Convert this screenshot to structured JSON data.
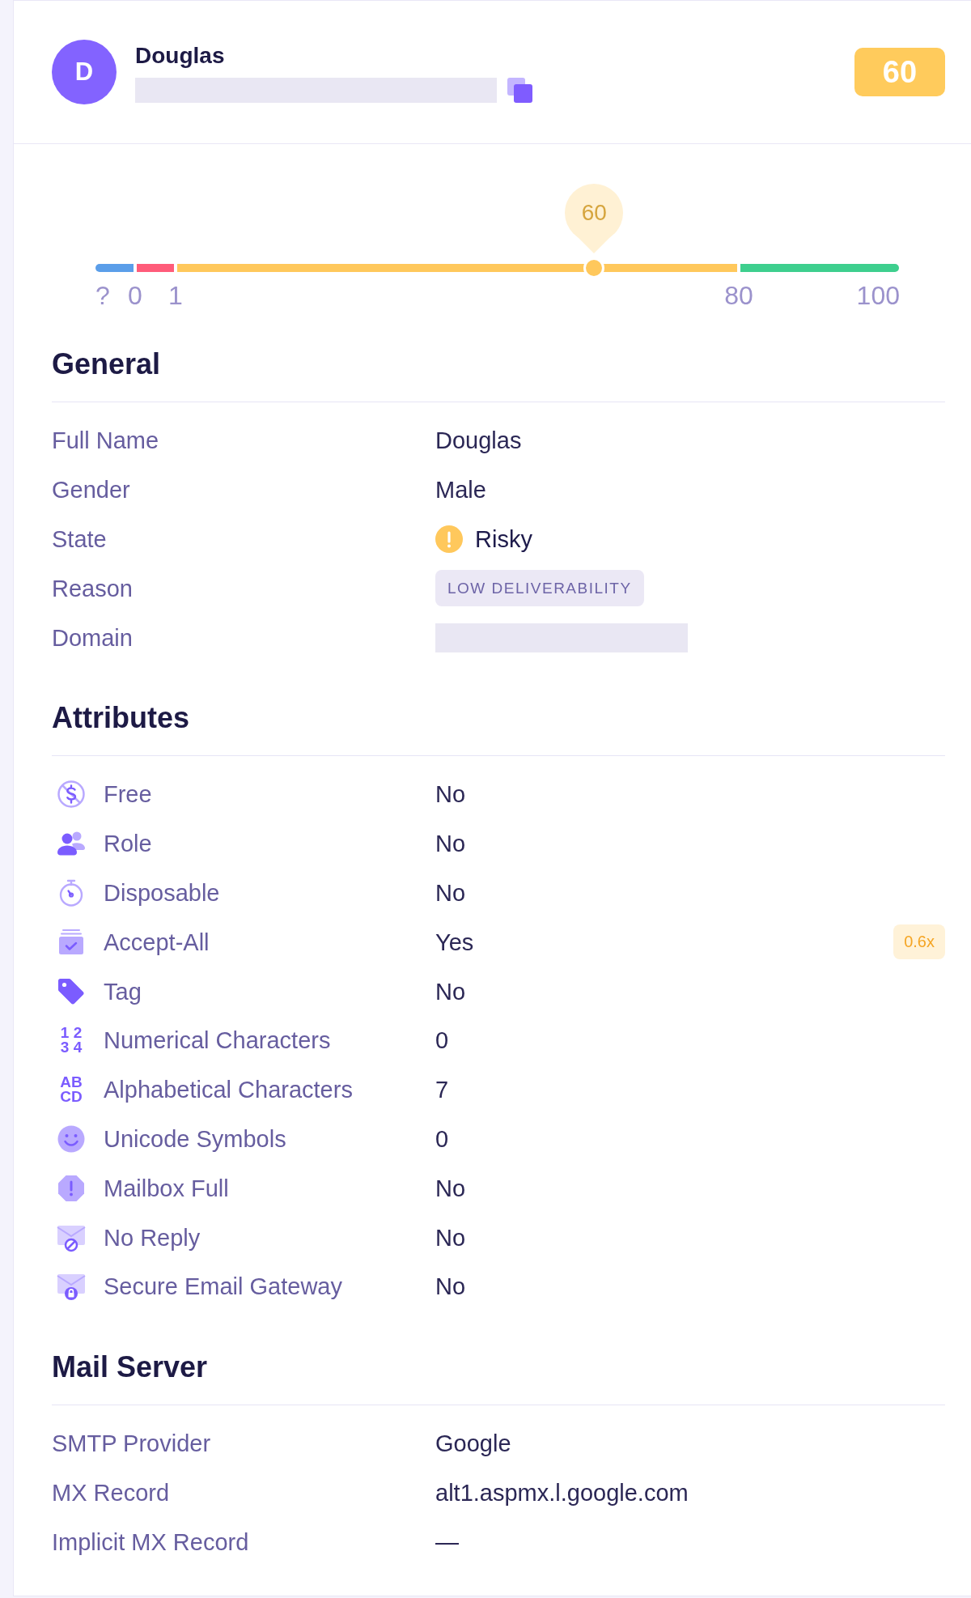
{
  "header": {
    "avatar_initial": "D",
    "name": "Douglas",
    "email_redacted": true,
    "score": "60"
  },
  "gauge": {
    "pin_label": "60",
    "level": 0.62,
    "segments": [
      {
        "color": "#5b9ee9"
      },
      {
        "color": "#ff5c7a"
      },
      {
        "color": "#ffc85c"
      },
      {
        "color": "#3ecf8e"
      }
    ],
    "scale_labels": [
      "?",
      "0",
      "1",
      "80",
      "100"
    ]
  },
  "sections": [
    {
      "title": "General",
      "kind": "fields",
      "rows": [
        {
          "label": "Full Name",
          "kind": "text",
          "value": "Douglas"
        },
        {
          "label": "Gender",
          "kind": "text",
          "value": "Male"
        },
        {
          "label": "State",
          "kind": "status",
          "value": "Risky"
        },
        {
          "label": "Reason",
          "kind": "tag",
          "value": "LOW DELIVERABILITY"
        },
        {
          "label": "Domain",
          "kind": "redacted"
        }
      ]
    },
    {
      "title": "Attributes",
      "kind": "attributes",
      "rows": [
        {
          "label": "Free",
          "value": "No"
        },
        {
          "label": "Role",
          "value": "No"
        },
        {
          "label": "Disposable",
          "value": "No"
        },
        {
          "label": "Accept-All",
          "value": "Yes",
          "multiplier": "0.6x"
        },
        {
          "label": "Tag",
          "value": "No"
        },
        {
          "label": "Numerical Characters",
          "value": "0",
          "icon_text": [
            "1 2",
            "3 4"
          ]
        },
        {
          "label": "Alphabetical Characters",
          "value": "7",
          "icon_text": [
            "AB",
            "CD"
          ]
        },
        {
          "label": "Unicode Symbols",
          "value": "0"
        },
        {
          "label": "Mailbox Full",
          "value": "No"
        },
        {
          "label": "No Reply",
          "value": "No"
        },
        {
          "label": "Secure Email Gateway",
          "value": "No"
        }
      ]
    },
    {
      "title": "Mail Server",
      "kind": "fields",
      "rows": [
        {
          "label": "SMTP Provider",
          "kind": "text",
          "value": "Google"
        },
        {
          "label": "MX Record",
          "kind": "text",
          "value": "alt1.aspmx.l.google.com"
        },
        {
          "label": "Implicit MX Record",
          "kind": "text",
          "value": "—"
        }
      ]
    }
  ]
}
